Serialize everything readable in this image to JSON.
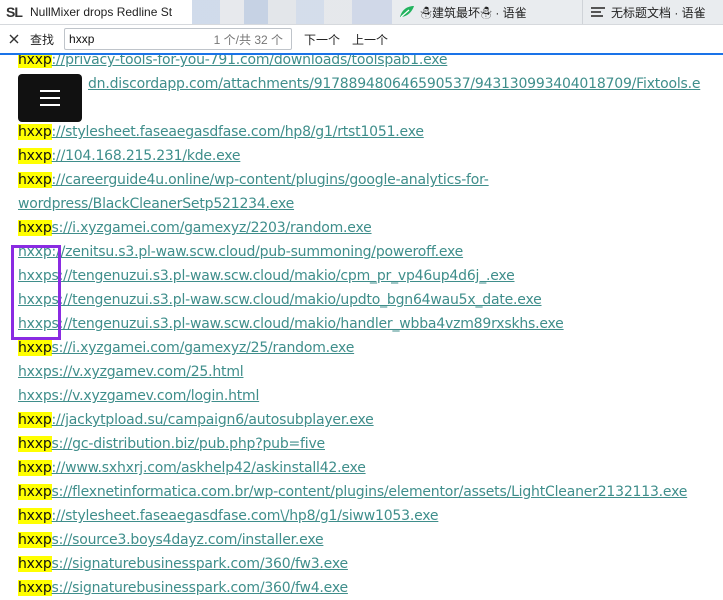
{
  "tabs": [
    {
      "logo": "SL",
      "title": "NullMixer drops Redline St"
    },
    {
      "icon": "leaf-icon",
      "title": "☃建筑最坏☃ · 语雀"
    },
    {
      "icon": "doc-icon",
      "title": "无标题文档 · 语雀"
    }
  ],
  "findbar": {
    "label": "查找",
    "query": "hxxp",
    "count": "1 个/共 32 个",
    "next": "下一个",
    "prev": "上一个"
  },
  "lines": [
    {
      "hl": "hxxp",
      "rest": "://privacy-tools-for-you-791.com/downloads/toolspab1.exe"
    },
    {
      "hl": "",
      "rest": "dn.discordapp.com/attachments/917889480646590537/943130993404018709/Fixtools.e"
    },
    {
      "hl": "hxxp",
      "rest": "://stylesheet.faseaegasdfase.com/hp8/g1/rtst1051.exe"
    },
    {
      "hl": "hxxp",
      "rest": "://104.168.215.231/kde.exe"
    },
    {
      "hl": "hxxp",
      "rest": "://careerguide4u.online/wp-content/plugins/google-analytics-for-"
    },
    {
      "hl": "",
      "rest": "wordpress/BlackCleanerSetp521234.exe"
    },
    {
      "hl": "hxxp",
      "rest": "s://i.xyzgamei.com/gamexyz/2203/random.exe"
    },
    {
      "hl": "",
      "rest": "hxxp://zenitsu.s3.pl-waw.scw.cloud/pub-summoning/poweroff.exe"
    },
    {
      "hl": "",
      "rest": "hxxps://tengenuzui.s3.pl-waw.scw.cloud/makio/cpm_pr_vp46up4d6j_.exe"
    },
    {
      "hl": "",
      "rest": "hxxps://tengenuzui.s3.pl-waw.scw.cloud/makio/updto_bgn64wau5x_date.exe"
    },
    {
      "hl": "",
      "rest": "hxxps://tengenuzui.s3.pl-waw.scw.cloud/makio/handler_wbba4vzm89rxskhs.exe"
    },
    {
      "hl": "hxxp",
      "rest": "s://i.xyzgamei.com/gamexyz/25/random.exe"
    },
    {
      "hl": "",
      "rest": "hxxps://v.xyzgamev.com/25.html"
    },
    {
      "hl": "",
      "rest": "hxxps://v.xyzgamev.com/login.html"
    },
    {
      "hl": "hxxp",
      "rest": "://jackytpload.su/campaign6/autosubplayer.exe"
    },
    {
      "hl": "hxxp",
      "rest": "s://gc-distribution.biz/pub.php?pub=five"
    },
    {
      "hl": "hxxp",
      "rest": "://www.sxhxrj.com/askhelp42/askinstall42.exe"
    },
    {
      "hl": "hxxp",
      "rest": "s://flexnetinformatica.com.br/wp-content/plugins/elementor/assets/LightCleaner2132113.exe"
    },
    {
      "hl": "hxxp",
      "rest": "://stylesheet.faseaegasdfase.com\\/hp8/g1/siww1053.exe"
    },
    {
      "hl": "hxxp",
      "rest": "s://source3.boys4dayz.com/installer.exe"
    },
    {
      "hl": "hxxp",
      "rest": "s://signaturebusinesspark.com/360/fw3.exe"
    },
    {
      "hl": "hxxp",
      "rest": "s://signaturebusinesspark.com/360/fw4.exe"
    }
  ],
  "colors": {
    "highlight": "#ffff00",
    "link": "#3f8e8b",
    "annotation_box": "#8a2be2",
    "findbar_accent": "#1a73e8"
  }
}
